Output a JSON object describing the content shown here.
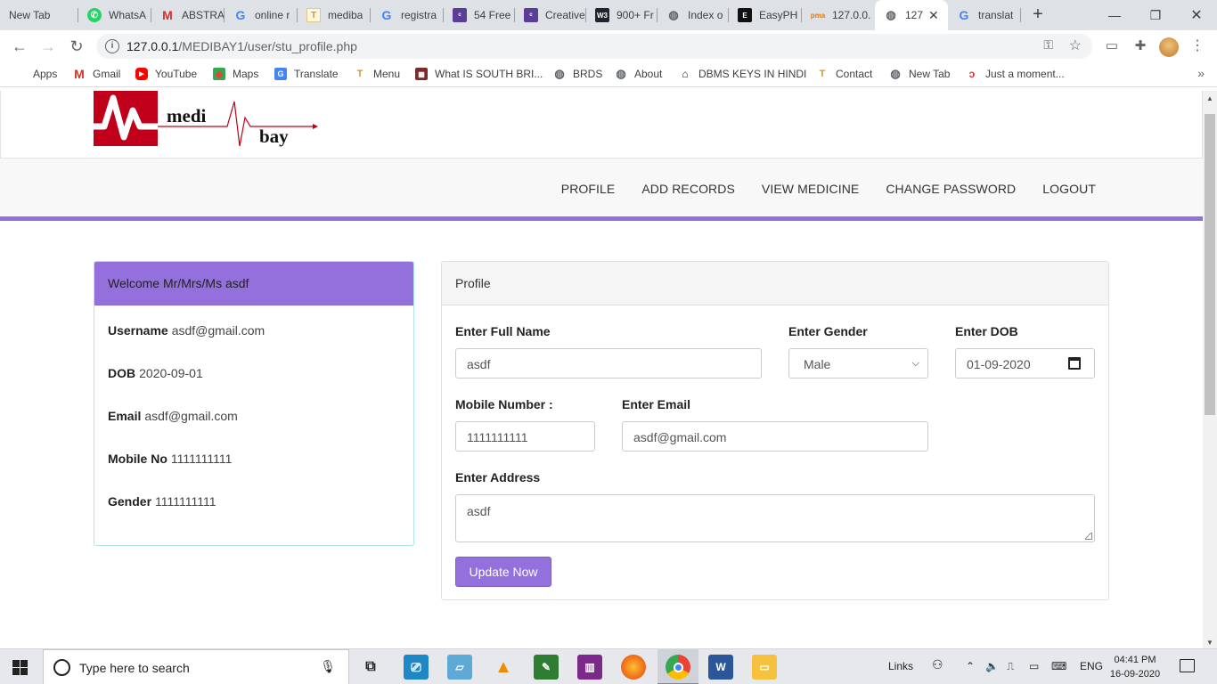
{
  "browser": {
    "tabs": [
      {
        "title": "New Tab",
        "favicon": "none"
      },
      {
        "title": "WhatsA",
        "favicon": "whatsapp-icon"
      },
      {
        "title": "ABSTRA",
        "favicon": "gmail-icon"
      },
      {
        "title": "online r",
        "favicon": "google-icon"
      },
      {
        "title": "mediba",
        "favicon": "medibay-icon"
      },
      {
        "title": "registra",
        "favicon": "google-icon"
      },
      {
        "title": "54 Free",
        "favicon": "colorlib-icon"
      },
      {
        "title": "Creative",
        "favicon": "colorlib-icon"
      },
      {
        "title": "900+ Fr",
        "favicon": "w3layouts-icon"
      },
      {
        "title": "Index o",
        "favicon": "globe-icon"
      },
      {
        "title": "EasyPH",
        "favicon": "easyphp-icon"
      },
      {
        "title": "127.0.0.",
        "favicon": "phpmyadmin-icon"
      },
      {
        "title": "127",
        "favicon": "globe-icon",
        "active": true
      },
      {
        "title": "translat",
        "favicon": "google-icon"
      }
    ],
    "url_host": "127.0.0.1",
    "url_path": "/MEDIBAY1/user/stu_profile.php",
    "bookmarks": [
      {
        "label": "Apps",
        "icon": "apps-grid-icon"
      },
      {
        "label": "Gmail",
        "icon": "gmail-icon"
      },
      {
        "label": "YouTube",
        "icon": "youtube-icon"
      },
      {
        "label": "Maps",
        "icon": "maps-icon"
      },
      {
        "label": "Translate",
        "icon": "translate-icon"
      },
      {
        "label": "Menu",
        "icon": "medibay-icon"
      },
      {
        "label": "What IS SOUTH BRI...",
        "icon": "image-icon"
      },
      {
        "label": "BRDS",
        "icon": "globe-icon"
      },
      {
        "label": "About",
        "icon": "globe-icon"
      },
      {
        "label": "DBMS KEYS IN HINDI",
        "icon": "book-icon"
      },
      {
        "label": "Contact",
        "icon": "medibay-icon"
      },
      {
        "label": "New Tab",
        "icon": "globe-icon"
      },
      {
        "label": "Just a moment...",
        "icon": "cloudflare-icon"
      }
    ]
  },
  "site": {
    "logo": {
      "part1": "medi",
      "part2": "bay"
    },
    "nav": [
      "PROFILE",
      "ADD RECORDS",
      "VIEW MEDICINE",
      "CHANGE PASSWORD",
      "LOGOUT"
    ],
    "accent_color": "#9370db"
  },
  "welcome": {
    "heading": "Welcome Mr/Mrs/Ms asdf",
    "rows": [
      {
        "label": "Username",
        "value": "asdf@gmail.com"
      },
      {
        "label": "DOB",
        "value": "2020-09-01"
      },
      {
        "label": "Email",
        "value": "asdf@gmail.com"
      },
      {
        "label": "Mobile No",
        "value": "1111111111"
      },
      {
        "label": "Gender",
        "value": "1111111111"
      }
    ]
  },
  "profile": {
    "heading": "Profile",
    "full_name_label": "Enter Full Name",
    "full_name_value": "asdf",
    "gender_label": "Enter Gender",
    "gender_value": "Male",
    "dob_label": "Enter DOB",
    "dob_value": "01-09-2020",
    "mobile_label": "Mobile Number :",
    "mobile_value": "1111111111",
    "email_label": "Enter Email",
    "email_value": "asdf@gmail.com",
    "address_label": "Enter Address",
    "address_value": "asdf",
    "submit_label": "Update Now"
  },
  "taskbar": {
    "search_placeholder": "Type here to search",
    "links_label": "Links",
    "language": "ENG",
    "time": "04:41 PM",
    "date": "16-09-2020"
  }
}
